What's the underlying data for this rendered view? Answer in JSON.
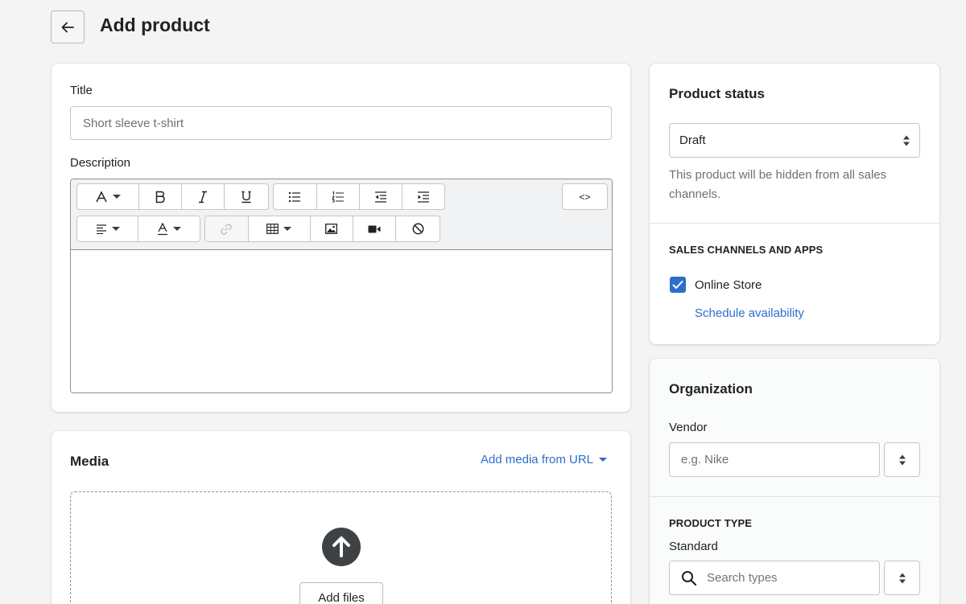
{
  "header": {
    "title": "Add product",
    "back_icon": "arrow-left-icon"
  },
  "details": {
    "title_label": "Title",
    "title_placeholder": "Short sleeve t-shirt",
    "description_label": "Description",
    "toolbar_row1": [
      "font-format",
      "bold",
      "italic",
      "underline",
      "bullet-list",
      "numbered-list",
      "outdent",
      "indent"
    ],
    "toolbar_row2": [
      "align",
      "text-color",
      "link",
      "table",
      "image",
      "video",
      "clear-formatting"
    ],
    "code_button": "<>"
  },
  "media": {
    "heading": "Media",
    "add_from_url": "Add media from URL",
    "add_files": "Add files"
  },
  "status": {
    "heading": "Product status",
    "selected": "Draft",
    "help": "This product will be hidden from all sales channels.",
    "channels_heading": "SALES CHANNELS AND APPS",
    "online_store": "Online Store",
    "online_store_checked": true,
    "schedule": "Schedule availability"
  },
  "organization": {
    "heading": "Organization",
    "vendor_label": "Vendor",
    "vendor_placeholder": "e.g. Nike",
    "product_type_heading": "PRODUCT TYPE",
    "product_type_value": "Standard",
    "search_placeholder": "Search types"
  },
  "colors": {
    "accent": "#2c6ecb",
    "checkbox": "#2c6ecb",
    "background": "#f4f4f4"
  }
}
